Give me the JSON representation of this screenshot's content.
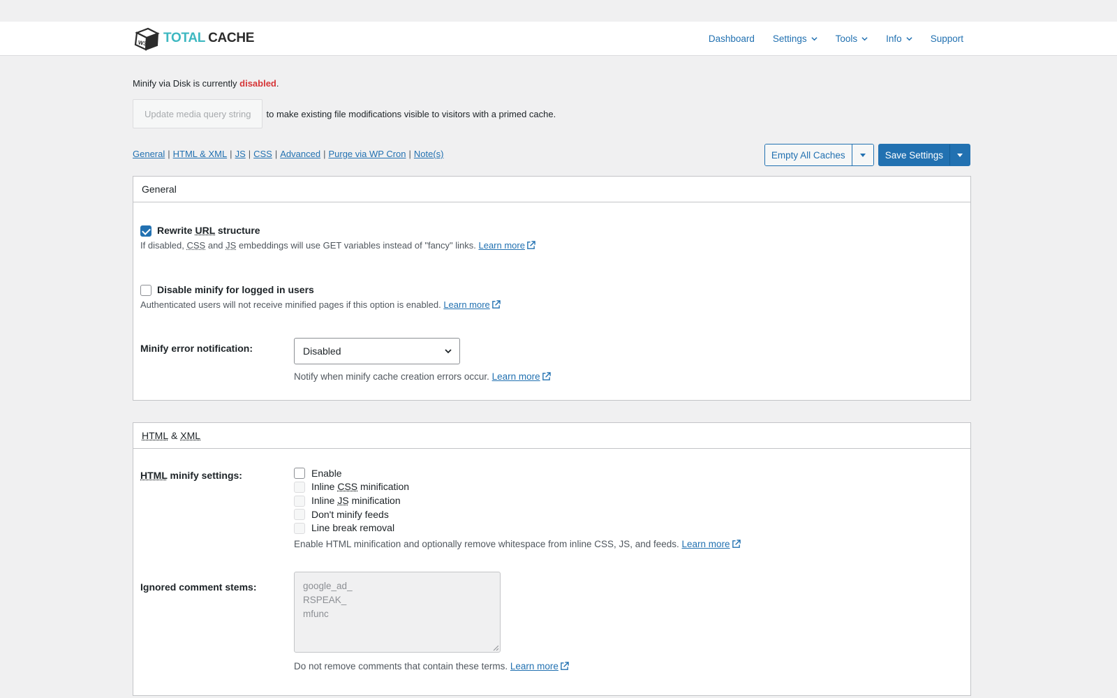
{
  "header": {
    "logo": {
      "badge": "W3",
      "word1": "TOTAL",
      "word2": "CACHE"
    },
    "nav": [
      {
        "label": "Dashboard",
        "dropdown": false
      },
      {
        "label": "Settings",
        "dropdown": true
      },
      {
        "label": "Tools",
        "dropdown": true
      },
      {
        "label": "Info",
        "dropdown": true
      },
      {
        "label": "Support",
        "dropdown": false
      }
    ]
  },
  "status": {
    "prefix": "Minify via Disk is currently ",
    "state": "disabled",
    "suffix": "."
  },
  "media_query": {
    "button_label": "Update media query string",
    "after_text": "to make existing file modifications visible to visitors with a primed cache."
  },
  "anchors": [
    "General",
    "HTML & XML",
    "JS",
    "CSS",
    "Advanced",
    "Purge via WP Cron",
    "Note(s)"
  ],
  "actions": {
    "empty_caches": "Empty All Caches",
    "save_settings": "Save Settings"
  },
  "general": {
    "title": "General",
    "rewrite": {
      "label_pre": "Rewrite ",
      "label_abbr": "URL",
      "label_post": " structure",
      "checked": true,
      "desc_1": "If disabled, ",
      "desc_css": "CSS",
      "desc_2": " and ",
      "desc_js": "JS",
      "desc_3": " embeddings will use GET variables instead of \"fancy\" links. ",
      "learn_more": "Learn more"
    },
    "logged_in": {
      "label": "Disable minify for logged in users",
      "checked": false,
      "desc": "Authenticated users will not receive minified pages if this option is enabled. ",
      "learn_more": "Learn more"
    },
    "error_notification": {
      "label": "Minify error notification:",
      "value": "Disabled",
      "desc": "Notify when minify cache creation errors occur. ",
      "learn_more": "Learn more"
    }
  },
  "html_xml": {
    "title_html": "HTML",
    "title_amp": " & ",
    "title_xml": "XML",
    "settings_label_abbr": "HTML",
    "settings_label_rest": " minify settings:",
    "options": {
      "enable": "Enable",
      "inline_css_pre": "Inline ",
      "inline_css_abbr": "CSS",
      "inline_css_post": " minification",
      "inline_js_pre": "Inline ",
      "inline_js_abbr": "JS",
      "inline_js_post": " minification",
      "feeds": "Don't minify feeds",
      "line_break": "Line break removal"
    },
    "options_desc": "Enable HTML minification and optionally remove whitespace from inline CSS, JS, and feeds. ",
    "options_learn_more": "Learn more",
    "ignored_label": "Ignored comment stems:",
    "ignored_line1": "google_ad_",
    "ignored_line2": "RSPEAK_",
    "ignored_line3": "mfunc",
    "ignored_desc": "Do not remove comments that contain these terms. ",
    "ignored_learn_more": "Learn more"
  }
}
